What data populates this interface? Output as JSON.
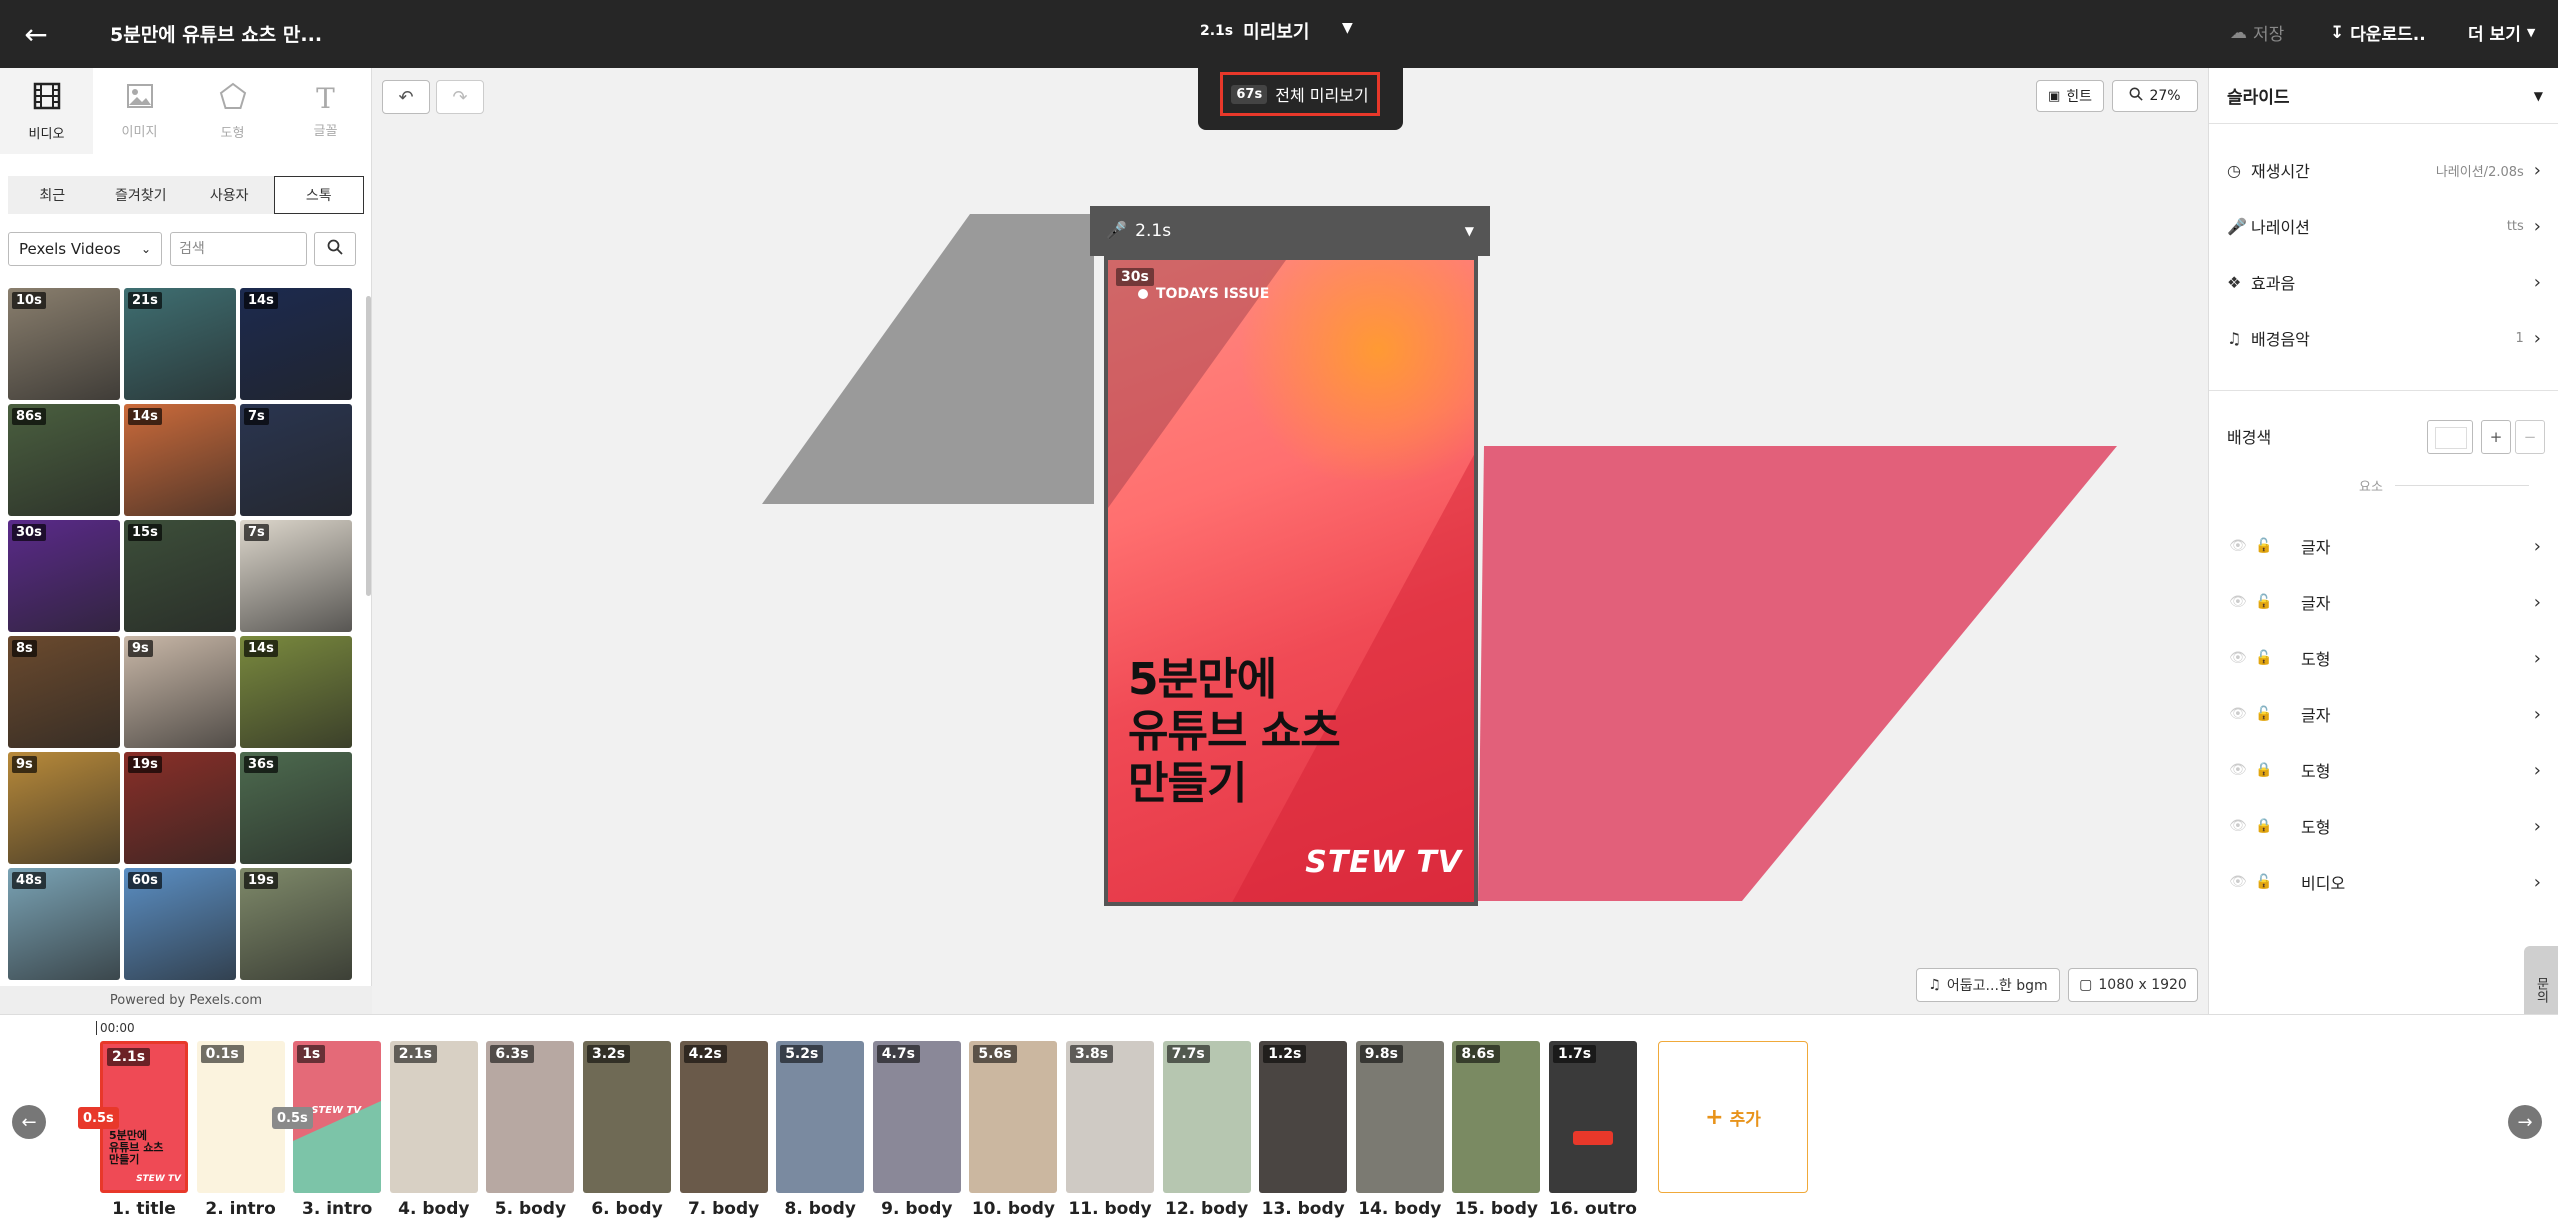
{
  "topbar": {
    "project_title": "5분만에 유튜브 쇼츠 만...",
    "preview_seconds": "2.1s",
    "preview_label": "미리보기",
    "save_label": "저장",
    "download_label": "다운로드..",
    "more_label": "더 보기"
  },
  "preview_dropdown": {
    "seconds": "67s",
    "label": "전체 미리보기"
  },
  "left_panel": {
    "tabs": [
      {
        "label": "비디오",
        "icon": "film-icon",
        "active": true
      },
      {
        "label": "이미지",
        "icon": "image-icon",
        "active": false
      },
      {
        "label": "도형",
        "icon": "pentagon-icon",
        "active": false
      },
      {
        "label": "글꼴",
        "icon": "text-icon",
        "active": false
      }
    ],
    "source_tabs": [
      "최근",
      "즐겨찾기",
      "사용자",
      "스톡"
    ],
    "source_select": "Pexels Videos",
    "search_placeholder": "검색",
    "thumbnails": [
      {
        "dur": "10s",
        "color": "#8a7f6e"
      },
      {
        "dur": "21s",
        "color": "#3f6f72"
      },
      {
        "dur": "14s",
        "color": "#1c2a4f"
      },
      {
        "dur": "86s",
        "color": "#4a5f3f"
      },
      {
        "dur": "14s",
        "color": "#cc6b3b"
      },
      {
        "dur": "7s",
        "color": "#2a3550"
      },
      {
        "dur": "30s",
        "color": "#5a2a8a"
      },
      {
        "dur": "15s",
        "color": "#3d4f3a"
      },
      {
        "dur": "7s",
        "color": "#ddd7cc"
      },
      {
        "dur": "8s",
        "color": "#6b4a2e"
      },
      {
        "dur": "9s",
        "color": "#c9b8a8"
      },
      {
        "dur": "14s",
        "color": "#7a8a3e"
      },
      {
        "dur": "9s",
        "color": "#b88a3a"
      },
      {
        "dur": "19s",
        "color": "#8a2f28"
      },
      {
        "dur": "36s",
        "color": "#4d6b4f"
      },
      {
        "dur": "48s",
        "color": "#7aa3b5"
      },
      {
        "dur": "60s",
        "color": "#5b8fc4"
      },
      {
        "dur": "19s",
        "color": "#7f8a6a"
      }
    ],
    "powered_by": "Powered by Pexels.com"
  },
  "canvas": {
    "hint_label": "힌트",
    "zoom_label": "27%",
    "narration_seconds": "2.1s",
    "slide": {
      "duration": "30s",
      "topic": "TODAYS ISSUE",
      "headline": "5분만에\n유튜브 쇼츠\n만들기",
      "brand": "STEW TV"
    },
    "bgm_label": "어둡고...한 bgm",
    "resolution_label": "1080 x 1920"
  },
  "right_panel": {
    "header": "슬라이드",
    "settings": [
      {
        "label": "재생시간",
        "icon": "clock-icon",
        "value": "나레이션/2.08s"
      },
      {
        "label": "나레이션",
        "icon": "mic-icon",
        "value": "tts"
      },
      {
        "label": "효과음",
        "icon": "sound-effect-icon",
        "value": ""
      },
      {
        "label": "배경음악",
        "icon": "music-icon",
        "value": "1"
      }
    ],
    "bg_color_label": "배경색",
    "elements_label": "요소",
    "elements": [
      {
        "name": "글자",
        "locked": false
      },
      {
        "name": "글자",
        "locked": false
      },
      {
        "name": "도형",
        "locked": false
      },
      {
        "name": "글자",
        "locked": false
      },
      {
        "name": "도형",
        "locked": true
      },
      {
        "name": "도형",
        "locked": true
      },
      {
        "name": "비디오",
        "locked": false
      }
    ],
    "side_tab": "문의"
  },
  "timeline": {
    "time": "00:00",
    "add_label": "추가",
    "clips": [
      {
        "dur": "2.1s",
        "label": "1. title",
        "color": "#ef4a55",
        "selected": true
      },
      {
        "dur": "0.1s",
        "label": "2. intro",
        "color": "#fbf3de",
        "selected": false
      },
      {
        "dur": "1s",
        "label": "3. intro",
        "color": "#e46a78",
        "selected": false
      },
      {
        "dur": "2.1s",
        "label": "4. body",
        "color": "#d8d0c4",
        "selected": false
      },
      {
        "dur": "6.3s",
        "label": "5. body",
        "color": "#b7a8a2",
        "selected": false
      },
      {
        "dur": "3.2s",
        "label": "6. body",
        "color": "#6f6a55",
        "selected": false
      },
      {
        "dur": "4.2s",
        "label": "7. body",
        "color": "#6a5a4a",
        "selected": false
      },
      {
        "dur": "5.2s",
        "label": "8. body",
        "color": "#7a8aa0",
        "selected": false
      },
      {
        "dur": "4.7s",
        "label": "9. body",
        "color": "#8a8898",
        "selected": false
      },
      {
        "dur": "5.6s",
        "label": "10. body",
        "color": "#cbb7a0",
        "selected": false
      },
      {
        "dur": "3.8s",
        "label": "11. body",
        "color": "#cfcac4",
        "selected": false
      },
      {
        "dur": "7.7s",
        "label": "12. body",
        "color": "#b6c6b0",
        "selected": false
      },
      {
        "dur": "1.2s",
        "label": "13. body",
        "color": "#4a4542",
        "selected": false
      },
      {
        "dur": "9.8s",
        "label": "14. body",
        "color": "#7b7a72",
        "selected": false
      },
      {
        "dur": "8.6s",
        "label": "15. body",
        "color": "#7a8a62",
        "selected": false
      },
      {
        "dur": "1.7s",
        "label": "16. outro",
        "color": "#3a3a3a",
        "selected": false
      }
    ],
    "transitions": [
      {
        "label": "0.5s",
        "color": "#e8382a"
      },
      {
        "label": "0.5s",
        "color": "#8a8a8a"
      }
    ],
    "clip1_text": "5분만에\n유튜브 쇼츠\n만들기",
    "clip1_brand": "STEW TV",
    "clip3_brand": "STEW TV"
  },
  "colors": {
    "topbar": "#262626",
    "accent_red": "#e8382a",
    "accent_orange": "#f0a93a",
    "shape_gray": "#9a9a9a",
    "shape_pink": "#e2607a"
  }
}
